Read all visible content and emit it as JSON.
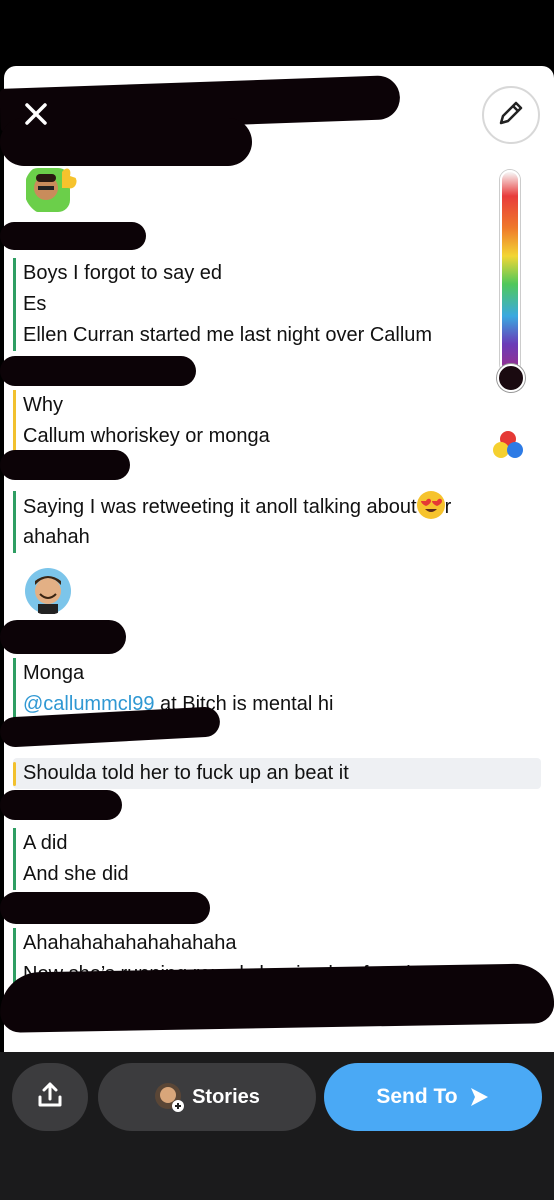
{
  "toolbar": {
    "undo_icon": "undo-icon",
    "pencil_icon": "pencil-icon",
    "palette_icon": "color-palette-icon",
    "close_icon": "close-icon"
  },
  "messages": {
    "block1": [
      "Boys I forgot to say ed",
      "Es",
      "Ellen Curran started me last night over Callum"
    ],
    "block2": [
      "Why",
      "Callum whoriskey or monga"
    ],
    "block3": [
      "Saying I was retweeting it anoll talking about",
      "ahahah"
    ],
    "block4_line1": "Monga",
    "block4_mention": "@callummcl99",
    "block4_rest": " at Bitch is mental hi",
    "block5": [
      "Shoulda told her to fuck up an beat it"
    ],
    "block6": [
      "A did",
      "And she did"
    ],
    "block7": [
      "Ahahahahahahahahaha",
      "Now she’s running round showing her face is"
    ],
    "block3_trailing": "r"
  },
  "bottom": {
    "stories_label": "Stories",
    "send_label": "Send To"
  },
  "colors": {
    "accent_blue": "#4aa9f5",
    "bar_green": "#2f9e63",
    "bar_yellow": "#f2c12e",
    "mention": "#2f98d3"
  }
}
